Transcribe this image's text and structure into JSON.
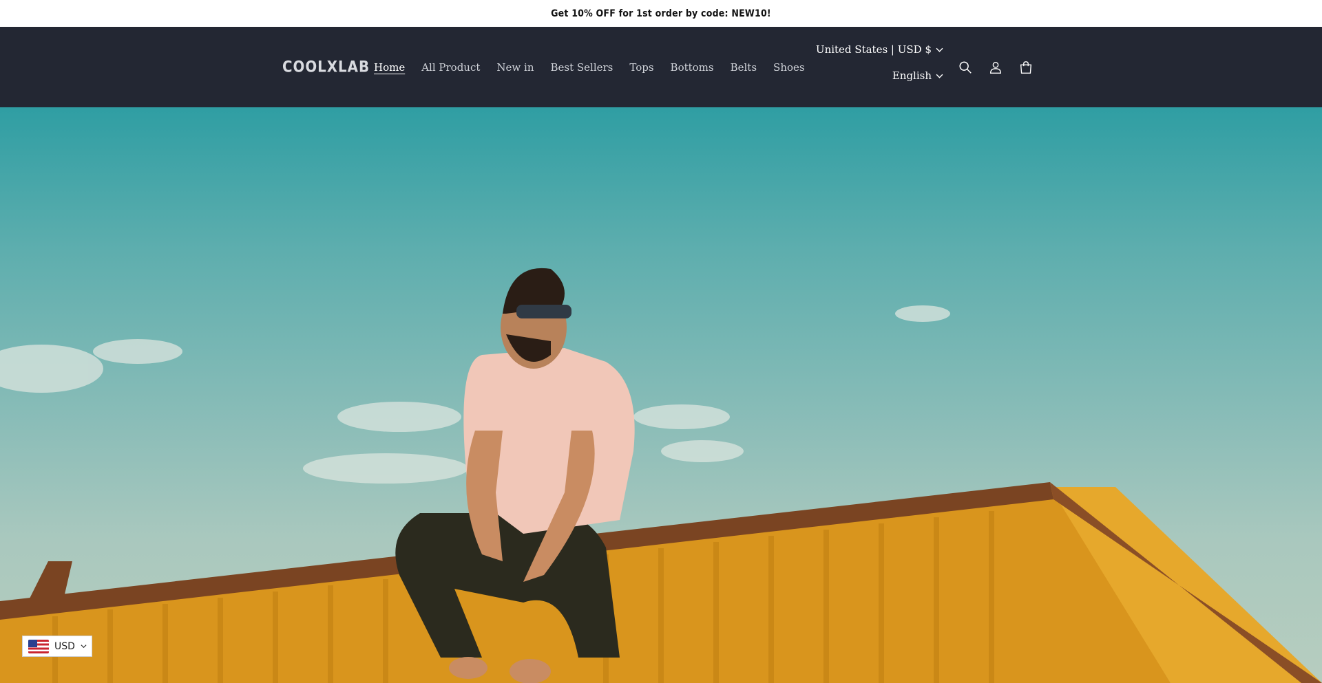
{
  "announcement": {
    "text": "Get 10% OFF for 1st order by code: NEW10!"
  },
  "header": {
    "logo": "COOLXLAB",
    "nav": [
      {
        "label": "Home",
        "active": true
      },
      {
        "label": "All Product"
      },
      {
        "label": "New in"
      },
      {
        "label": "Best Sellers"
      },
      {
        "label": "Tops"
      },
      {
        "label": "Bottoms"
      },
      {
        "label": "Belts"
      },
      {
        "label": "Shoes"
      }
    ],
    "country_currency": "United States | USD $",
    "language": "English",
    "icons": [
      "search-icon",
      "account-icon",
      "cart-icon"
    ]
  },
  "currency_badge": {
    "code": "USD"
  },
  "colors": {
    "header_bg": "#232733",
    "announcement_bg": "#ffffff",
    "sky": "#5eaeae",
    "container": "#d79a22"
  }
}
